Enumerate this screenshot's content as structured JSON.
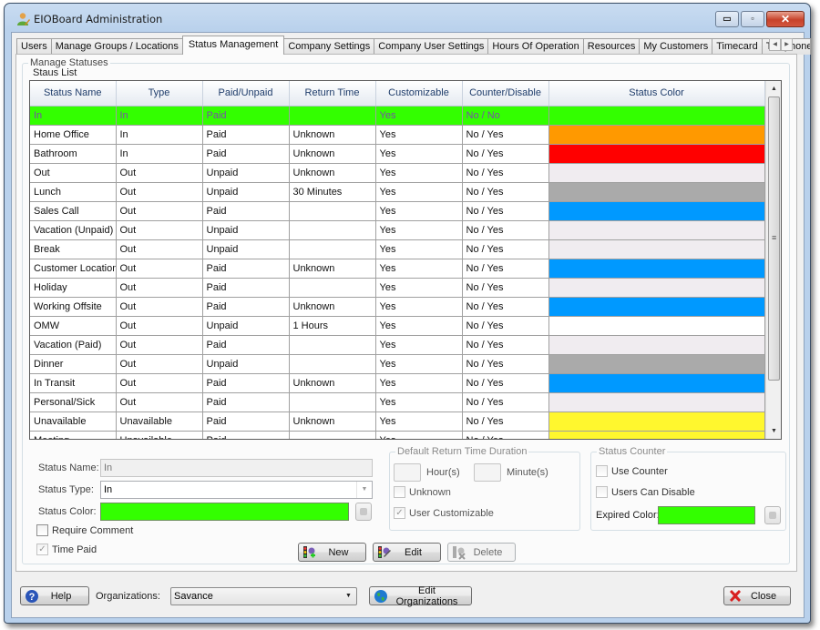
{
  "window": {
    "title": "EIOBoard Administration",
    "controls": {
      "minimize": "▭",
      "maximize": "▫",
      "close": "✕"
    }
  },
  "tabs": [
    {
      "label": "Users",
      "active": false
    },
    {
      "label": "Manage Groups / Locations",
      "active": false
    },
    {
      "label": "Status Management",
      "active": true
    },
    {
      "label": "Company Settings",
      "active": false
    },
    {
      "label": "Company User Settings",
      "active": false
    },
    {
      "label": "Hours Of Operation",
      "active": false
    },
    {
      "label": "Resources",
      "active": false
    },
    {
      "label": "My Customers",
      "active": false
    },
    {
      "label": "Timecard",
      "active": false
    },
    {
      "label": "Telephone",
      "active": false
    }
  ],
  "tab_scroll": {
    "left": "◀",
    "right": "▶"
  },
  "manage_statuses": {
    "group_label": "Manage Statuses",
    "list_label": "Staus List",
    "columns": [
      "Status Name",
      "Type",
      "Paid/Unpaid",
      "Return Time",
      "Customizable",
      "Counter/Disable",
      "Status Color"
    ],
    "rows": [
      {
        "name": "In",
        "type": "In",
        "paid": "Paid",
        "return_time": "",
        "customizable": "Yes",
        "counter_disable": "No / No",
        "color": "#33ff00",
        "selected": true
      },
      {
        "name": "Home Office",
        "type": "In",
        "paid": "Paid",
        "return_time": "Unknown",
        "customizable": "Yes",
        "counter_disable": "No / Yes",
        "color": "#ff9900"
      },
      {
        "name": "Bathroom",
        "type": "In",
        "paid": "Paid",
        "return_time": "Unknown",
        "customizable": "Yes",
        "counter_disable": "No / Yes",
        "color": "#ff0000"
      },
      {
        "name": "Out",
        "type": "Out",
        "paid": "Unpaid",
        "return_time": "Unknown",
        "customizable": "Yes",
        "counter_disable": "No / Yes",
        "color": "#f0ecf0"
      },
      {
        "name": "Lunch",
        "type": "Out",
        "paid": "Unpaid",
        "return_time": "30 Minutes",
        "customizable": "Yes",
        "counter_disable": "No / Yes",
        "color": "#aaaaaa"
      },
      {
        "name": "Sales Call",
        "type": "Out",
        "paid": "Paid",
        "return_time": "",
        "customizable": "Yes",
        "counter_disable": "No / Yes",
        "color": "#0099ff"
      },
      {
        "name": "Vacation (Unpaid)",
        "type": "Out",
        "paid": "Unpaid",
        "return_time": "",
        "customizable": "Yes",
        "counter_disable": "No / Yes",
        "color": "#f0ecf0"
      },
      {
        "name": "Break",
        "type": "Out",
        "paid": "Unpaid",
        "return_time": "",
        "customizable": "Yes",
        "counter_disable": "No / Yes",
        "color": "#f0ecf0"
      },
      {
        "name": "Customer Location",
        "type": "Out",
        "paid": "Paid",
        "return_time": "Unknown",
        "customizable": "Yes",
        "counter_disable": "No / Yes",
        "color": "#0099ff"
      },
      {
        "name": "Holiday",
        "type": "Out",
        "paid": "Paid",
        "return_time": "",
        "customizable": "Yes",
        "counter_disable": "No / Yes",
        "color": "#f0ecf0"
      },
      {
        "name": "Working Offsite",
        "type": "Out",
        "paid": "Paid",
        "return_time": "Unknown",
        "customizable": "Yes",
        "counter_disable": "No / Yes",
        "color": "#0099ff"
      },
      {
        "name": "OMW",
        "type": "Out",
        "paid": "Unpaid",
        "return_time": "1 Hours",
        "customizable": "Yes",
        "counter_disable": "No / Yes",
        "color": "#ffffff"
      },
      {
        "name": "Vacation (Paid)",
        "type": "Out",
        "paid": "Paid",
        "return_time": "",
        "customizable": "Yes",
        "counter_disable": "No / Yes",
        "color": "#f0ecf0"
      },
      {
        "name": "Dinner",
        "type": "Out",
        "paid": "Unpaid",
        "return_time": "",
        "customizable": "Yes",
        "counter_disable": "No / Yes",
        "color": "#aaaaaa"
      },
      {
        "name": "In Transit",
        "type": "Out",
        "paid": "Paid",
        "return_time": "Unknown",
        "customizable": "Yes",
        "counter_disable": "No / Yes",
        "color": "#0099ff"
      },
      {
        "name": "Personal/Sick",
        "type": "Out",
        "paid": "Paid",
        "return_time": "",
        "customizable": "Yes",
        "counter_disable": "No / Yes",
        "color": "#f0ecf0"
      },
      {
        "name": "Unavailable",
        "type": "Unavailable",
        "paid": "Paid",
        "return_time": "Unknown",
        "customizable": "Yes",
        "counter_disable": "No / Yes",
        "color": "#fff72e"
      },
      {
        "name": "Meeting",
        "type": "Unavailable",
        "paid": "Paid",
        "return_time": "",
        "customizable": "Yes",
        "counter_disable": "No / Yes",
        "color": "#fff72e"
      }
    ],
    "scroll": {
      "up": "▲",
      "down": "▼",
      "grip": "≡"
    }
  },
  "editor": {
    "status_name_label": "Status Name:",
    "status_name_value": "In",
    "status_type_label": "Status Type:",
    "status_type_value": "In",
    "status_color_label": "Status Color:",
    "status_color_value": "#33ff00",
    "require_comment_label": "Require Comment",
    "require_comment_checked": false,
    "time_paid_label": "Time Paid",
    "time_paid_checked": true,
    "check_glyph": "✓"
  },
  "return_time": {
    "group_label": "Default Return Time Duration",
    "hours_value": "",
    "hours_label": "Hour(s)",
    "minutes_value": "",
    "minutes_label": "Minute(s)",
    "unknown_label": "Unknown",
    "unknown_checked": false,
    "user_customizable_label": "User Customizable",
    "user_customizable_checked": true
  },
  "status_counter": {
    "group_label": "Status Counter",
    "use_counter_label": "Use Counter",
    "use_counter_checked": false,
    "users_can_disable_label": "Users Can Disable",
    "users_can_disable_checked": false,
    "expired_color_label": "Expired Color:",
    "expired_color_value": "#33ff00"
  },
  "actions": {
    "new_label": "New",
    "edit_label": "Edit",
    "delete_label": "Delete"
  },
  "footer": {
    "help_label": "Help",
    "organizations_label": "Organizations:",
    "organization_value": "Savance",
    "edit_organizations_label": "Edit Organizations",
    "close_label": "Close"
  }
}
